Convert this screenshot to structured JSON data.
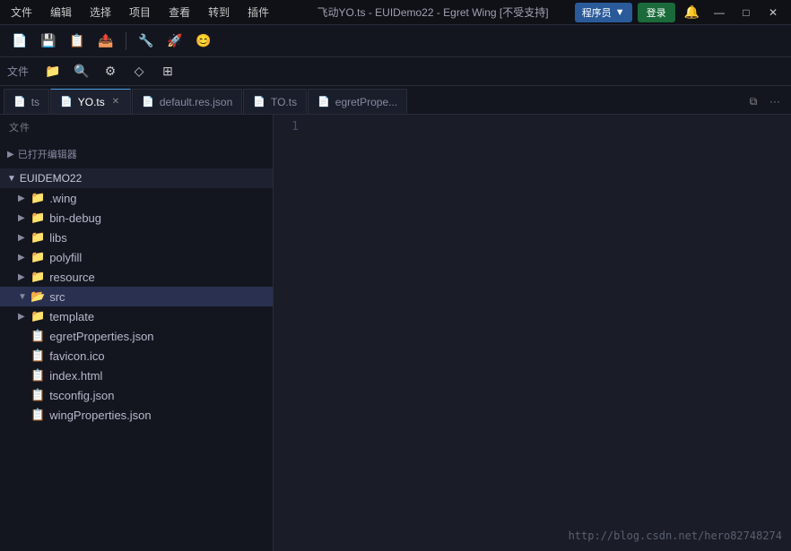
{
  "titlebar": {
    "menu_items": [
      "文件",
      "编辑",
      "选择",
      "项目",
      "查看",
      "转到",
      "插件"
    ],
    "title": "飞动YO.ts - EUIDemo22 - Egret Wing [不受支持]",
    "program_label": "程序员",
    "login_label": "登录",
    "minimize": "—",
    "maximize": "□",
    "close": "✕"
  },
  "toolbar": {
    "buttons": [
      "📄",
      "💾",
      "📋",
      "📤",
      "🔧",
      "🚀",
      "😊"
    ]
  },
  "second_toolbar": {
    "file_label": "文件",
    "buttons": [
      "📁",
      "🔍",
      "⚙",
      "◇",
      "⊞"
    ]
  },
  "tabs": [
    {
      "id": "ts-partial",
      "label": "ts",
      "icon": "📄",
      "active": false,
      "closable": false
    },
    {
      "id": "yo-ts",
      "label": "YO.ts",
      "icon": "📄",
      "active": true,
      "closable": true
    },
    {
      "id": "default-res",
      "label": "default.res.json",
      "icon": "📄",
      "active": false,
      "closable": false
    },
    {
      "id": "to-ts",
      "label": "TO.ts",
      "icon": "📄",
      "active": false,
      "closable": false
    },
    {
      "id": "egret-prop",
      "label": "egretPrope...",
      "icon": "📄",
      "active": false,
      "closable": false
    }
  ],
  "sidebar": {
    "header": "文件",
    "open_editors_label": "已打开编辑器",
    "project_name": "EUIDEMO22",
    "tree": [
      {
        "name": ".wing",
        "type": "folder",
        "depth": 1,
        "expanded": false
      },
      {
        "name": "bin-debug",
        "type": "folder",
        "depth": 1,
        "expanded": false
      },
      {
        "name": "libs",
        "type": "folder",
        "depth": 1,
        "expanded": false
      },
      {
        "name": "polyfill",
        "type": "folder",
        "depth": 1,
        "expanded": false
      },
      {
        "name": "resource",
        "type": "folder",
        "depth": 1,
        "expanded": false
      },
      {
        "name": "src",
        "type": "folder",
        "depth": 1,
        "expanded": true,
        "selected": true
      },
      {
        "name": "template",
        "type": "folder",
        "depth": 1,
        "expanded": false
      },
      {
        "name": "egretProperties.json",
        "type": "file",
        "depth": 1,
        "icon": "json"
      },
      {
        "name": "favicon.ico",
        "type": "file",
        "depth": 1,
        "icon": "ico"
      },
      {
        "name": "index.html",
        "type": "file",
        "depth": 1,
        "icon": "html"
      },
      {
        "name": "tsconfig.json",
        "type": "file",
        "depth": 1,
        "icon": "json"
      },
      {
        "name": "wingProperties.json",
        "type": "file",
        "depth": 1,
        "icon": "json"
      }
    ]
  },
  "editor": {
    "line_numbers": [
      "1"
    ]
  },
  "watermark": {
    "text": "http://blog.csdn.net/hero82748274"
  }
}
